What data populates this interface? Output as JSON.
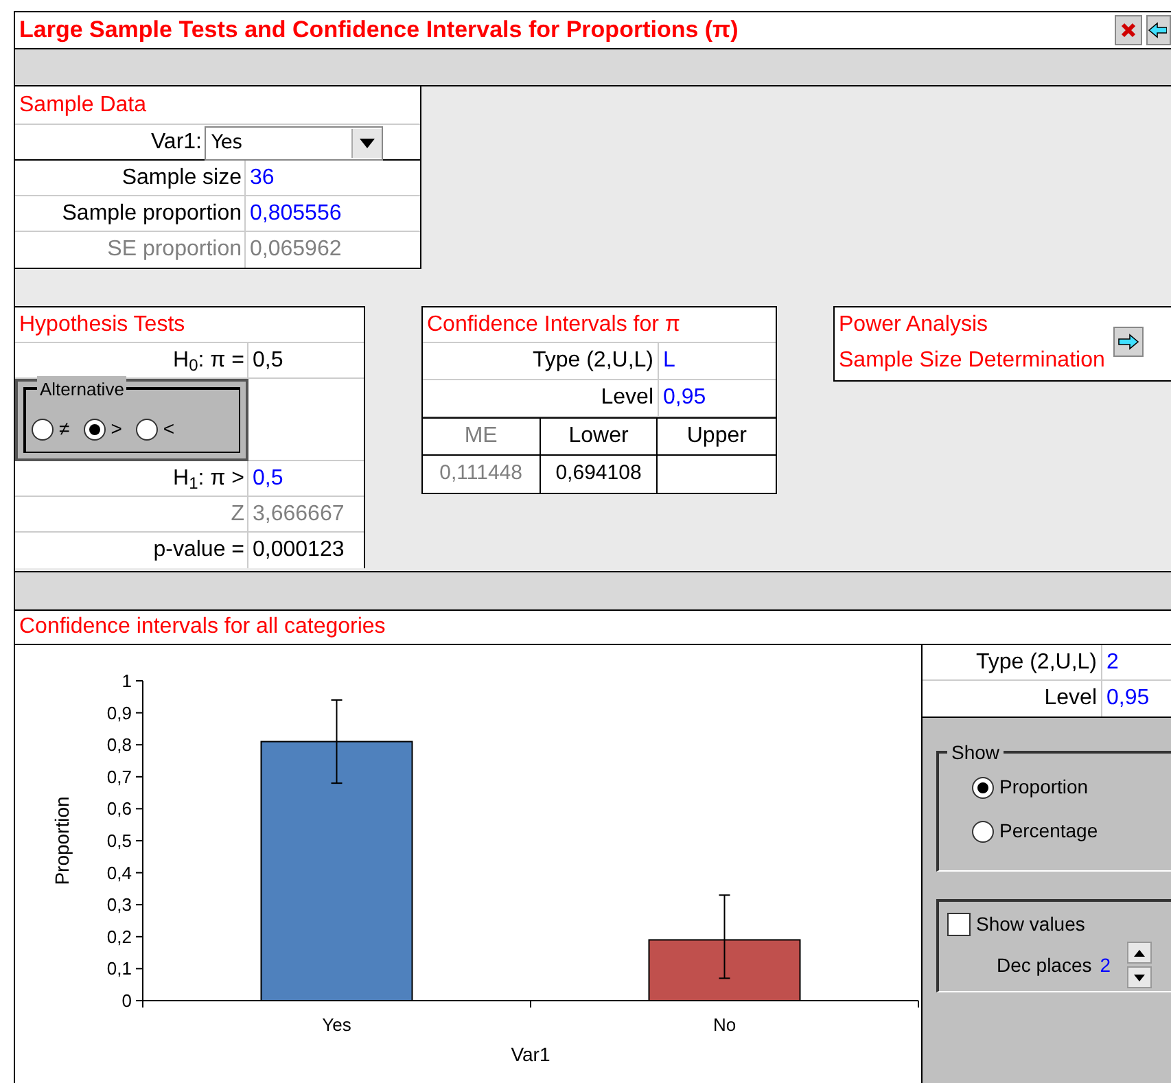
{
  "window": {
    "title": "Large Sample Tests and Confidence Intervals for Proportions (π)"
  },
  "sample_data": {
    "title": "Sample Data",
    "variable": {
      "label": "Var1:",
      "value": "Yes"
    },
    "rows": [
      {
        "label": "Sample size",
        "value": "36",
        "kind": "input"
      },
      {
        "label": "Sample proportion",
        "value": "0,805556",
        "kind": "input"
      },
      {
        "label": "SE proportion",
        "value": "0,065962",
        "kind": "muted"
      }
    ]
  },
  "hypothesis_tests": {
    "title": "Hypothesis Tests",
    "h0": {
      "label": "H$_{0}$: π =",
      "value": "0,5"
    },
    "alternative": {
      "title": "Alternative",
      "options": [
        {
          "label": "≠",
          "selected": false
        },
        {
          "label": ">",
          "selected": true
        },
        {
          "label": "<",
          "selected": false
        }
      ]
    },
    "rows": [
      {
        "label": "H$_{1}$: π >",
        "value": "0,5",
        "kind": "input"
      },
      {
        "label": "Z",
        "value": "3,666667",
        "kind": "muted"
      },
      {
        "label": "p-value =",
        "value": "0,000123",
        "kind": "computed"
      }
    ]
  },
  "confidence_intervals": {
    "title": "Confidence Intervals for π",
    "rows": [
      {
        "label": "Type (2,U,L)",
        "value": "L"
      },
      {
        "label": "Level",
        "value": "0,95"
      }
    ],
    "columns": [
      {
        "label": "ME",
        "kind": "muted"
      },
      {
        "label": "Lower",
        "kind": "computed"
      },
      {
        "label": "Upper",
        "kind": "computed"
      }
    ],
    "values": [
      {
        "value": "0,111448",
        "kind": "muted"
      },
      {
        "value": "0,694108",
        "kind": "computed"
      }
    ]
  },
  "power_analysis": {
    "links": [
      "Power Analysis",
      "Sample Size Determination"
    ]
  },
  "all_categories": {
    "title": "Confidence intervals for all categories",
    "chart_data": {
      "type": "bar",
      "xlabel": "Var1",
      "ylabel": "Proportion",
      "categories": [
        "Yes",
        "No"
      ],
      "series": [
        {
          "values": [
            0.81,
            0.19
          ],
          "errors": [
            [
              0.68,
              0.94
            ],
            [
              0.07,
              0.33
            ]
          ]
        }
      ],
      "colors": [
        "#4f81bd",
        "#c0504d"
      ],
      "ylim": [
        0,
        1
      ],
      "yticks": [
        {
          "value": 0,
          "label": "0"
        },
        {
          "value": 0.1,
          "label": "0,1"
        },
        {
          "value": 0.2,
          "label": "0,2"
        },
        {
          "value": 0.3,
          "label": "0,3"
        },
        {
          "value": 0.4,
          "label": "0,4"
        },
        {
          "value": 0.5,
          "label": "0,5"
        },
        {
          "value": 0.6,
          "label": "0,6"
        },
        {
          "value": 0.7,
          "label": "0,7"
        },
        {
          "value": 0.8,
          "label": "0,8"
        },
        {
          "value": 0.9,
          "label": "0,9"
        },
        {
          "value": 1,
          "label": "1"
        }
      ]
    },
    "settings": [
      {
        "label": "Type (2,U,L)",
        "value": "2"
      },
      {
        "label": "Level",
        "value": "0,95"
      }
    ],
    "show": {
      "title": "Show",
      "options": [
        {
          "label": "Proportion",
          "selected": true
        },
        {
          "label": "Percentage",
          "selected": false
        }
      ]
    },
    "show_values": {
      "label": "Show values",
      "checked": false
    },
    "dec_places": {
      "label": "Dec places",
      "value": "2"
    }
  }
}
